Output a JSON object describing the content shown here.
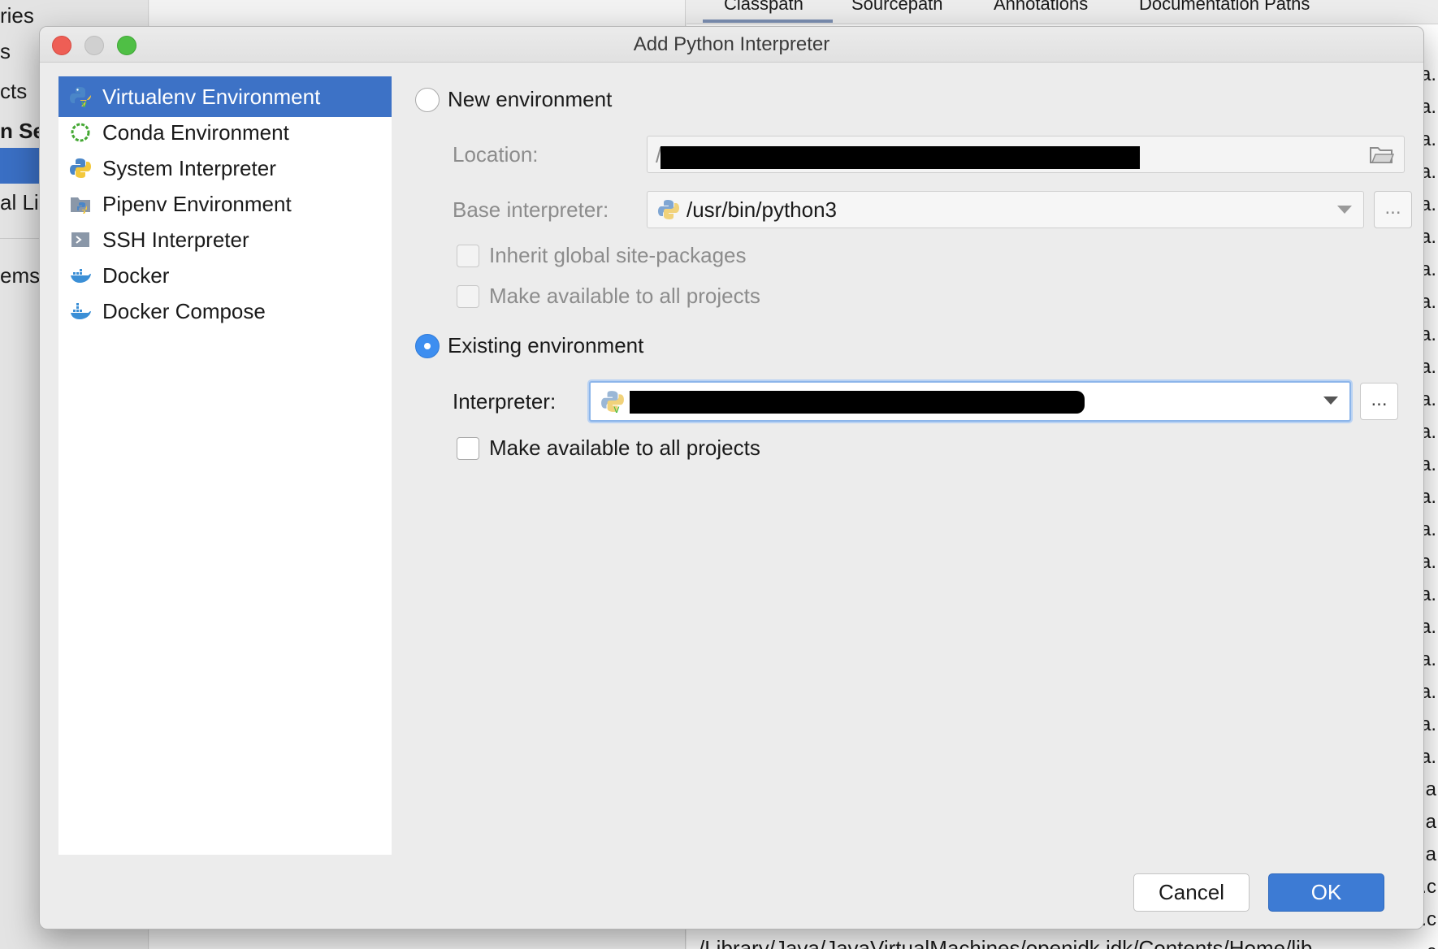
{
  "background": {
    "left_items": [
      "ries",
      "s",
      "cts",
      "n Se",
      "al Lib",
      "ems"
    ],
    "tabs": [
      "Classpath",
      "Sourcepath",
      "Annotations",
      "Documentation Paths"
    ],
    "row_suffixes": [
      "a.",
      "a.",
      "a.",
      "a.",
      "a.",
      "a.",
      "a.",
      "a.",
      "a.",
      "a.",
      "a.",
      "a.",
      "a.",
      "a.",
      "a.",
      "a.",
      "a.",
      "a.",
      "a.",
      "a.",
      "a.",
      "a.",
      ".a",
      ".a",
      ".a",
      ".c",
      ".c",
      ".c"
    ],
    "bottom_path": "/Library/Java/JavaVirtualMachines/openjdk.jdk/Contents/Home/lib"
  },
  "dialog": {
    "title": "Add Python Interpreter",
    "sidebar": [
      {
        "label": "Virtualenv Environment",
        "icon": "virtualenv-icon",
        "selected": true
      },
      {
        "label": "Conda Environment",
        "icon": "conda-icon",
        "selected": false
      },
      {
        "label": "System Interpreter",
        "icon": "python-icon",
        "selected": false
      },
      {
        "label": "Pipenv Environment",
        "icon": "pipenv-icon",
        "selected": false
      },
      {
        "label": "SSH Interpreter",
        "icon": "ssh-icon",
        "selected": false
      },
      {
        "label": "Docker",
        "icon": "docker-icon",
        "selected": false
      },
      {
        "label": "Docker Compose",
        "icon": "docker-compose-icon",
        "selected": false
      }
    ],
    "new_env": {
      "radio_label": "New environment",
      "selected": false,
      "location_label": "Location:",
      "location_value": "/",
      "base_interpreter_label": "Base interpreter:",
      "base_interpreter_value": "/usr/bin/python3",
      "inherit_label": "Inherit global site-packages",
      "make_available_label": "Make available to all projects",
      "more_button": "..."
    },
    "existing_env": {
      "radio_label": "Existing environment",
      "selected": true,
      "interpreter_label": "Interpreter:",
      "make_available_label": "Make available to all projects",
      "make_available_checked": false,
      "more_button": "..."
    },
    "buttons": {
      "cancel": "Cancel",
      "ok": "OK"
    },
    "colors": {
      "selection": "#3d72c6",
      "ok_button": "#3d7bd4",
      "radio_checked": "#3d8ef0",
      "focus_ring": "#8cb5ea"
    }
  }
}
